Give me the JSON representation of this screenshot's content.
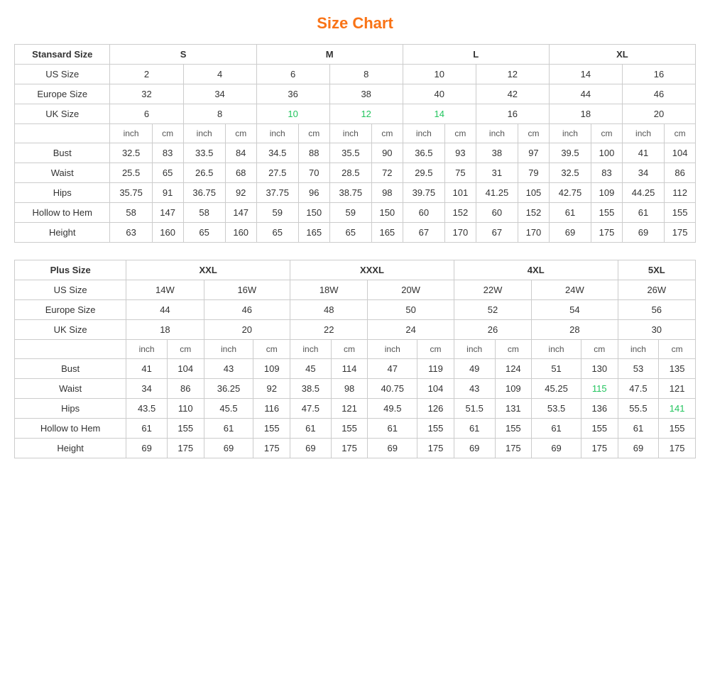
{
  "title": "Size Chart",
  "standard": {
    "table1": {
      "header_col": "Stansard Size",
      "size_groups": [
        "S",
        "M",
        "L",
        "XL"
      ],
      "us_size_label": "US Size",
      "us_sizes": [
        "2",
        "4",
        "6",
        "8",
        "10",
        "12",
        "14",
        "16"
      ],
      "europe_size_label": "Europe Size",
      "europe_sizes": [
        "32",
        "34",
        "36",
        "38",
        "40",
        "42",
        "44",
        "46"
      ],
      "uk_size_label": "UK Size",
      "uk_sizes": [
        "6",
        "8",
        "10",
        "12",
        "14",
        "16",
        "18",
        "20"
      ],
      "unit_label": [
        "inch",
        "cm",
        "inch",
        "cm",
        "inch",
        "cm",
        "inch",
        "cm",
        "inch",
        "cm",
        "inch",
        "cm",
        "inch",
        "cm",
        "inch",
        "cm"
      ],
      "measurements": [
        {
          "label": "Bust",
          "values": [
            "32.5",
            "83",
            "33.5",
            "84",
            "34.5",
            "88",
            "35.5",
            "90",
            "36.5",
            "93",
            "38",
            "97",
            "39.5",
            "100",
            "41",
            "104"
          ]
        },
        {
          "label": "Waist",
          "values": [
            "25.5",
            "65",
            "26.5",
            "68",
            "27.5",
            "70",
            "28.5",
            "72",
            "29.5",
            "75",
            "31",
            "79",
            "32.5",
            "83",
            "34",
            "86"
          ]
        },
        {
          "label": "Hips",
          "values": [
            "35.75",
            "91",
            "36.75",
            "92",
            "37.75",
            "96",
            "38.75",
            "98",
            "39.75",
            "101",
            "41.25",
            "105",
            "42.75",
            "109",
            "44.25",
            "112"
          ]
        },
        {
          "label": "Hollow to Hem",
          "values": [
            "58",
            "147",
            "58",
            "147",
            "59",
            "150",
            "59",
            "150",
            "60",
            "152",
            "60",
            "152",
            "61",
            "155",
            "61",
            "155"
          ]
        },
        {
          "label": "Height",
          "values": [
            "63",
            "160",
            "65",
            "160",
            "65",
            "165",
            "65",
            "165",
            "67",
            "170",
            "67",
            "170",
            "69",
            "175",
            "69",
            "175"
          ]
        }
      ]
    }
  },
  "plus": {
    "table2": {
      "header_col": "Plus Size",
      "size_groups": [
        "XXL",
        "XXXL",
        "4XL",
        "5XL"
      ],
      "us_size_label": "US Size",
      "us_sizes": [
        "14W",
        "16W",
        "18W",
        "20W",
        "22W",
        "24W",
        "26W"
      ],
      "europe_size_label": "Europe Size",
      "europe_sizes": [
        "44",
        "46",
        "48",
        "50",
        "52",
        "54",
        "56"
      ],
      "uk_size_label": "UK Size",
      "uk_sizes": [
        "18",
        "20",
        "22",
        "24",
        "26",
        "28",
        "30"
      ],
      "unit_label": [
        "inch",
        "cm",
        "inch",
        "cm",
        "inch",
        "cm",
        "inch",
        "cm",
        "inch",
        "cm",
        "inch",
        "cm",
        "inch",
        "cm"
      ],
      "measurements": [
        {
          "label": "Bust",
          "values": [
            "41",
            "104",
            "43",
            "109",
            "45",
            "114",
            "47",
            "119",
            "49",
            "124",
            "51",
            "130",
            "53",
            "135"
          ]
        },
        {
          "label": "Waist",
          "values": [
            "34",
            "86",
            "36.25",
            "92",
            "38.5",
            "98",
            "40.75",
            "104",
            "43",
            "109",
            "45.25",
            "115",
            "47.5",
            "121"
          ]
        },
        {
          "label": "Hips",
          "values": [
            "43.5",
            "110",
            "45.5",
            "116",
            "47.5",
            "121",
            "49.5",
            "126",
            "51.5",
            "131",
            "53.5",
            "136",
            "55.5",
            "141"
          ]
        },
        {
          "label": "Hollow to Hem",
          "values": [
            "61",
            "155",
            "61",
            "155",
            "61",
            "155",
            "61",
            "155",
            "61",
            "155",
            "61",
            "155",
            "61",
            "155"
          ]
        },
        {
          "label": "Height",
          "values": [
            "69",
            "175",
            "69",
            "175",
            "69",
            "175",
            "69",
            "175",
            "69",
            "175",
            "69",
            "175",
            "69",
            "175"
          ]
        }
      ]
    }
  }
}
